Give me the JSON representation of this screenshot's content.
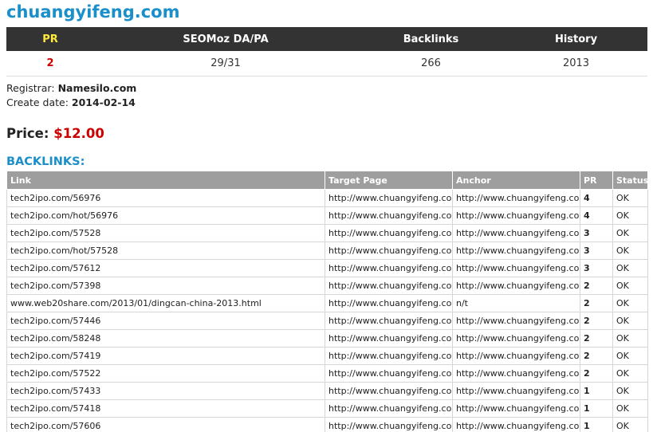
{
  "site": {
    "title": "chuangyifeng.com"
  },
  "summary": {
    "headers": {
      "pr": "PR",
      "seomoz": "SEOMoz DA/PA",
      "backlinks": "Backlinks",
      "history": "History"
    },
    "values": {
      "pr": "2",
      "seomoz": "29/31",
      "backlinks": "266",
      "history": "2013"
    }
  },
  "info": {
    "registrar_label": "Registrar:",
    "registrar": "Namesilo.com",
    "create_label": "Create date:",
    "create_date": "2014-02-14"
  },
  "price": {
    "label": "Price:",
    "amount": "$12.00"
  },
  "backlinks": {
    "heading": "BACKLINKS:",
    "columns": [
      "Link",
      "Target Page",
      "Anchor",
      "PR",
      "Status"
    ],
    "rows": [
      [
        "tech2ipo.com/56976",
        "http://www.chuangyifeng.com",
        "http://www.chuangyifeng.com",
        "4",
        "OK"
      ],
      [
        "tech2ipo.com/hot/56976",
        "http://www.chuangyifeng.com",
        "http://www.chuangyifeng.com",
        "4",
        "OK"
      ],
      [
        "tech2ipo.com/57528",
        "http://www.chuangyifeng.com",
        "http://www.chuangyifeng.com",
        "3",
        "OK"
      ],
      [
        "tech2ipo.com/hot/57528",
        "http://www.chuangyifeng.com",
        "http://www.chuangyifeng.com",
        "3",
        "OK"
      ],
      [
        "tech2ipo.com/57612",
        "http://www.chuangyifeng.com",
        "http://www.chuangyifeng.com",
        "3",
        "OK"
      ],
      [
        "tech2ipo.com/57398",
        "http://www.chuangyifeng.com",
        "http://www.chuangyifeng.com",
        "2",
        "OK"
      ],
      [
        "www.web20share.com/2013/01/dingcan-china-2013.html",
        "http://www.chuangyifeng.com/",
        "n/t",
        "2",
        "OK"
      ],
      [
        "tech2ipo.com/57446",
        "http://www.chuangyifeng.com",
        "http://www.chuangyifeng.com",
        "2",
        "OK"
      ],
      [
        "tech2ipo.com/58248",
        "http://www.chuangyifeng.com",
        "http://www.chuangyifeng.com",
        "2",
        "OK"
      ],
      [
        "tech2ipo.com/57419",
        "http://www.chuangyifeng.com",
        "http://www.chuangyifeng.com",
        "2",
        "OK"
      ],
      [
        "tech2ipo.com/57522",
        "http://www.chuangyifeng.com",
        "http://www.chuangyifeng.com",
        "2",
        "OK"
      ],
      [
        "tech2ipo.com/57433",
        "http://www.chuangyifeng.com",
        "http://www.chuangyifeng.com",
        "1",
        "OK"
      ],
      [
        "tech2ipo.com/57418",
        "http://www.chuangyifeng.com",
        "http://www.chuangyifeng.com",
        "1",
        "OK"
      ],
      [
        "tech2ipo.com/57606",
        "http://www.chuangyifeng.com",
        "http://www.chuangyifeng.com",
        "1",
        "OK"
      ]
    ]
  }
}
